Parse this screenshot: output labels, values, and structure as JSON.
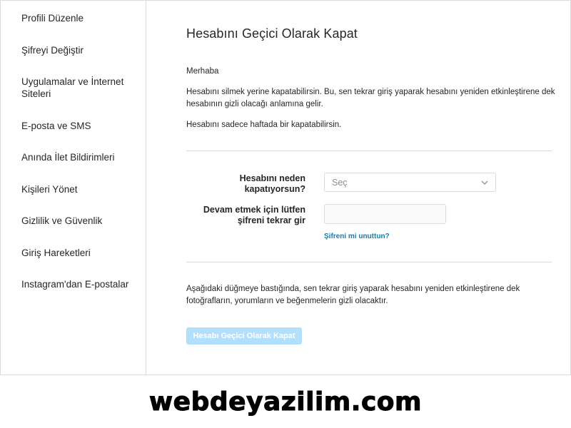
{
  "sidebar": {
    "items": [
      {
        "label": "Profili Düzenle"
      },
      {
        "label": "Şifreyi Değiştir"
      },
      {
        "label": "Uygulamalar ve İnternet Siteleri"
      },
      {
        "label": "E-posta ve SMS"
      },
      {
        "label": "Anında İlet Bildirimleri"
      },
      {
        "label": "Kişileri Yönet"
      },
      {
        "label": "Gizlilik ve Güvenlik"
      },
      {
        "label": "Giriş Hareketleri"
      },
      {
        "label": "Instagram'dan E-postalar"
      }
    ]
  },
  "main": {
    "title": "Hesabını Geçici Olarak Kapat",
    "greeting": "Merhaba",
    "info_text": "Hesabını silmek yerine kapatabilirsin. Bu, sen tekrar giriş yaparak hesabını yeniden etkinleştirene dek hesabının gizli olacağı anlamına gelir.",
    "frequency_text": "Hesabını sadece haftada bir kapatabilirsin.",
    "form": {
      "reason_label": "Hesabını neden kapatıyorsun?",
      "reason_value": "Seç",
      "password_label": "Devam etmek için lütfen şifreni tekrar gir",
      "password_value": "",
      "forgot_link": "Şifreni mi unuttun?"
    },
    "footer_text": "Aşağıdaki düğmeye bastığında, sen tekrar giriş yaparak hesabını yeniden etkinleştirene dek fotoğrafların, yorumların ve beğenmelerin gizli olacaktır.",
    "submit_label": "Hesabı Geçici Olarak Kapat"
  },
  "watermark": {
    "text": "webdeyazilim.com"
  },
  "colors": {
    "border": "#dbdbdb",
    "text": "#262626",
    "placeholder": "#8e8e8e",
    "link": "#0f7fb5",
    "button_disabled": "#b2dffc"
  },
  "icons": {
    "select_chevron": "chevron-down-icon"
  }
}
